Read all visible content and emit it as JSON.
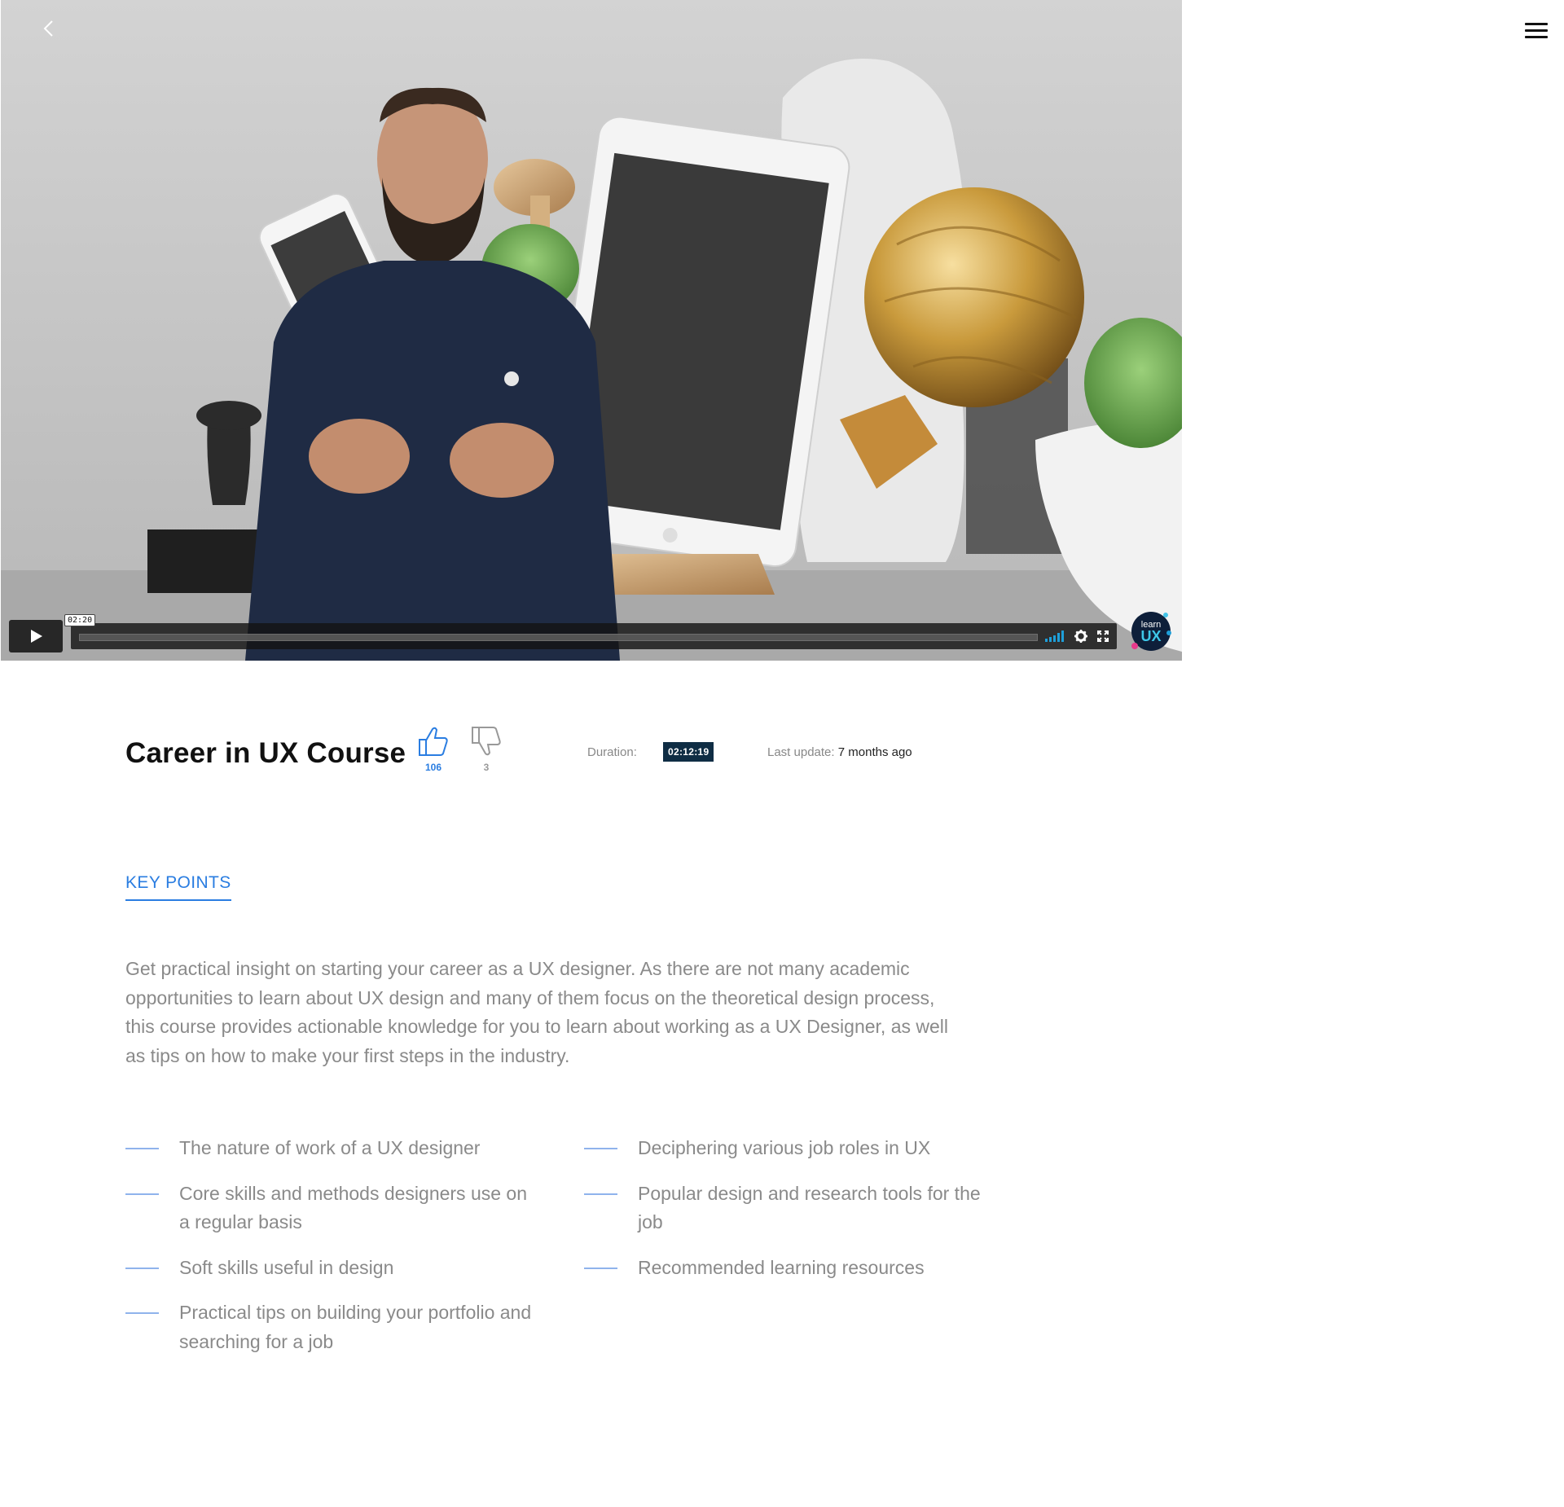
{
  "player": {
    "current_time": "02:20",
    "progress": 0.0
  },
  "course": {
    "title": "Career in UX Course",
    "likes": "106",
    "dislikes": "3",
    "duration_label": "Duration:",
    "duration_value": "02:12:19",
    "last_update_label": "Last update:",
    "last_update_value": "7 months ago"
  },
  "tabs": {
    "key_points": "KEY POINTS"
  },
  "description": "Get practical insight on starting your career as a UX designer. As there are not many academic opportunities to learn about UX design and many of them focus on the theoretical design process, this course provides actionable knowledge for you to learn about working as a UX Designer, as well as tips on how to make your first steps in the industry.",
  "points_left": [
    "The nature of work of a UX designer",
    "Core skills and methods designers use on a regular basis",
    "Soft skills useful in design",
    "Practical tips on building your portfolio and searching for a job"
  ],
  "points_right": [
    "Deciphering various job roles in UX",
    "Popular design and research tools for the job",
    "Recommended learning resources"
  ],
  "logo_text": {
    "line1": "learn",
    "line2": "UX"
  },
  "colors": {
    "accent": "#2a7de1",
    "badge_bg": "#0f2d44",
    "progress": "#1e9fd9"
  },
  "icons": {
    "back": "chevron-left-icon",
    "menu": "hamburger-menu-icon",
    "like": "thumbs-up-icon",
    "dislike": "thumbs-down-icon",
    "play": "play-icon",
    "volume": "volume-bars-icon",
    "settings": "gear-icon",
    "fullscreen": "fullscreen-icon"
  }
}
